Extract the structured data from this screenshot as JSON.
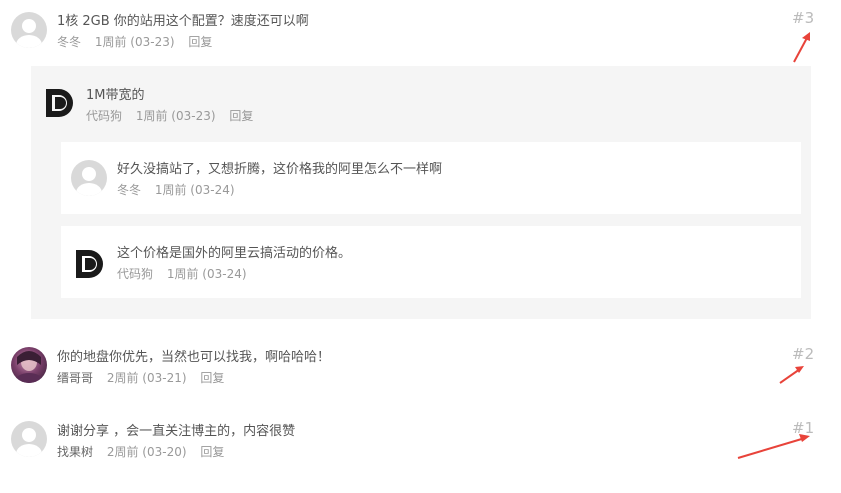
{
  "comments": [
    {
      "content": "1核 2GB 你的站用这个配置？速度还可以啊",
      "author": "冬冬",
      "time": "1周前 (03-23)",
      "reply": "回复",
      "floor": "#3"
    },
    {
      "content": "你的地盘你优先，当然也可以找我，啊哈哈哈！",
      "author": "缙哥哥",
      "time": "2周前 (03-21)",
      "reply": "回复",
      "floor": "#2"
    },
    {
      "content": "谢谢分享 ，会一直关注博主的，内容很赞",
      "author": "找果树",
      "time": "2周前 (03-20)",
      "reply": "回复",
      "floor": "#1"
    }
  ],
  "replies": [
    {
      "content": "1M带宽的",
      "author": "代码狗",
      "time": "1周前 (03-23)",
      "reply": "回复"
    },
    {
      "content": "好久没搞站了，又想折腾，这价格我的阿里怎么不一样啊",
      "author": "冬冬",
      "time": "1周前 (03-24)"
    },
    {
      "content": "这个价格是国外的阿里云搞活动的价格。",
      "author": "代码狗",
      "time": "1周前 (03-24)"
    }
  ],
  "colors": {
    "arrow": "#e8433a",
    "floor": "#bbbbbb",
    "reply_bg": "#f5f5f5"
  },
  "icons": {
    "default_avatar": "person-silhouette-icon",
    "logo_avatar": "dd-logo-icon",
    "photo_avatar": "user-photo-avatar"
  }
}
